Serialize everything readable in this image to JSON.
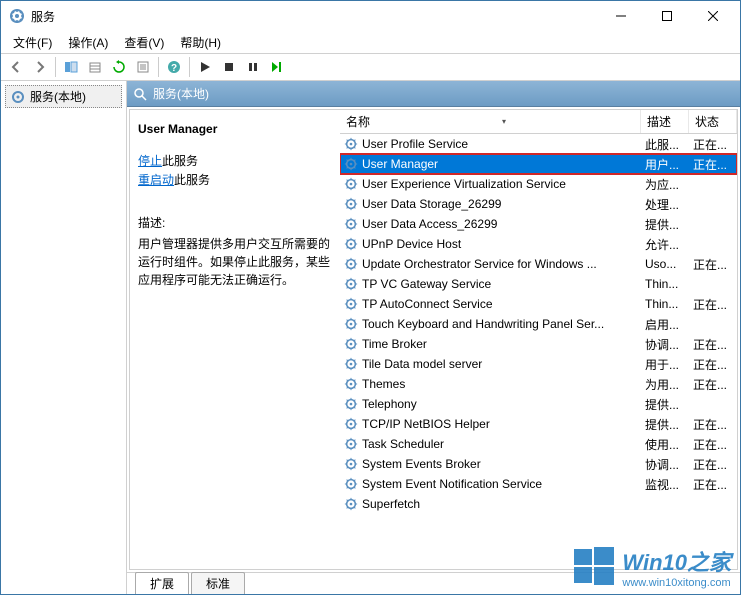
{
  "window": {
    "title": "服务"
  },
  "menus": [
    {
      "label": "文件(F)"
    },
    {
      "label": "操作(A)"
    },
    {
      "label": "查看(V)"
    },
    {
      "label": "帮助(H)"
    }
  ],
  "tree": {
    "root_label": "服务(本地)"
  },
  "right_header": {
    "label": "服务(本地)"
  },
  "detail": {
    "title": "User Manager",
    "stop_link": "停止",
    "stop_suffix": "此服务",
    "restart_link": "重启动",
    "restart_suffix": "此服务",
    "desc_label": "描述:",
    "desc": "用户管理器提供多用户交互所需要的运行时组件。如果停止此服务，某些应用程序可能无法正确运行。"
  },
  "columns": {
    "name": "名称",
    "desc": "描述",
    "status": "状态"
  },
  "services": [
    {
      "name": "User Profile Service",
      "desc": "此服...",
      "status": "正在..."
    },
    {
      "name": "User Manager",
      "desc": "用户...",
      "status": "正在...",
      "selected": true
    },
    {
      "name": "User Experience Virtualization Service",
      "desc": "为应...",
      "status": ""
    },
    {
      "name": "User Data Storage_26299",
      "desc": "处理...",
      "status": ""
    },
    {
      "name": "User Data Access_26299",
      "desc": "提供...",
      "status": ""
    },
    {
      "name": "UPnP Device Host",
      "desc": "允许...",
      "status": ""
    },
    {
      "name": "Update Orchestrator Service for Windows ...",
      "desc": "Uso...",
      "status": "正在..."
    },
    {
      "name": "TP VC Gateway Service",
      "desc": "Thin...",
      "status": ""
    },
    {
      "name": "TP AutoConnect Service",
      "desc": "Thin...",
      "status": "正在..."
    },
    {
      "name": "Touch Keyboard and Handwriting Panel Ser...",
      "desc": "启用...",
      "status": ""
    },
    {
      "name": "Time Broker",
      "desc": "协调...",
      "status": "正在..."
    },
    {
      "name": "Tile Data model server",
      "desc": "用于...",
      "status": "正在..."
    },
    {
      "name": "Themes",
      "desc": "为用...",
      "status": "正在..."
    },
    {
      "name": "Telephony",
      "desc": "提供...",
      "status": ""
    },
    {
      "name": "TCP/IP NetBIOS Helper",
      "desc": "提供...",
      "status": "正在..."
    },
    {
      "name": "Task Scheduler",
      "desc": "使用...",
      "status": "正在..."
    },
    {
      "name": "System Events Broker",
      "desc": "协调...",
      "status": "正在..."
    },
    {
      "name": "System Event Notification Service",
      "desc": "监视...",
      "status": "正在..."
    },
    {
      "name": "Superfetch",
      "desc": "",
      "status": ""
    }
  ],
  "tabs": {
    "extended": "扩展",
    "standard": "标准"
  },
  "watermark": {
    "title_en": "Win10",
    "title_cn": "之家",
    "url": "www.win10xitong.com"
  }
}
